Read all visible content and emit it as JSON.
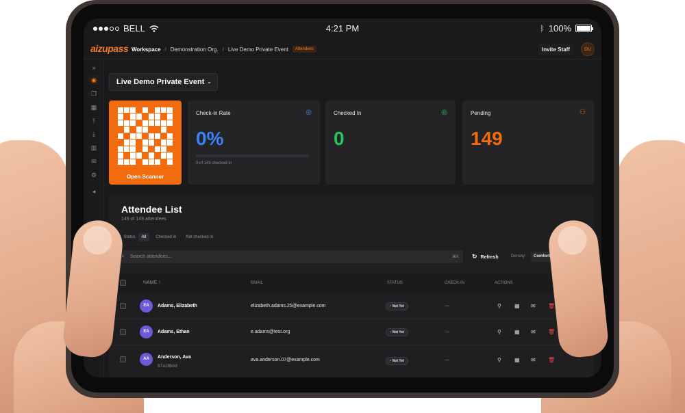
{
  "status_bar": {
    "carrier": "BELL",
    "time": "4:21 PM",
    "battery": "100%",
    "battery_level": 1.0
  },
  "header": {
    "logo": "aizupass",
    "breadcrumbs": [
      "Workspace",
      "Demonstration Org.",
      "Live Demo Private Event"
    ],
    "page_badge": "Attendees",
    "invite_label": "Invite Staff",
    "user_initials": "DU"
  },
  "sidebar": {
    "icons": [
      "expand-icon",
      "eye-icon",
      "layers-icon",
      "layout-icon",
      "upload-icon",
      "download-icon",
      "chart-icon",
      "badge-icon",
      "settings-icon",
      "collapse-icon"
    ]
  },
  "event_selector": {
    "label": "Live Demo Private Event"
  },
  "scanner": {
    "label": "Open Scanner"
  },
  "stats": {
    "checkin_rate": {
      "title": "Check-in Rate",
      "value": "0%",
      "subtext": "0 of 149 checked in",
      "progress": 0,
      "color": "#3b82f6"
    },
    "checked_in": {
      "title": "Checked In",
      "value": "0",
      "color": "#22c55e"
    },
    "pending": {
      "title": "Pending",
      "value": "149",
      "color": "#f26b0f"
    }
  },
  "attendee_list": {
    "title": "Attendee List",
    "subtitle": "149 of 149 attendees",
    "filter_label": "Status",
    "filters": [
      "All",
      "Checked in",
      "Not checked in"
    ],
    "active_filter": "All",
    "search_placeholder": "Search attendees...",
    "search_shortcut": "⌘K",
    "refresh_label": "Refresh",
    "density_label": "Density:",
    "density_value": "Comfortable",
    "columns": [
      "NAME",
      "EMAIL",
      "STATUS",
      "CHECK-IN",
      "ACTIONS"
    ],
    "rows": [
      {
        "initials": "EA",
        "name": "Adams, Elizabeth",
        "code": "",
        "email": "elizabeth.adams.25@example.com",
        "status": "Not Yet",
        "checkin": "—"
      },
      {
        "initials": "EA",
        "name": "Adams, Ethan",
        "code": "",
        "email": "e.adams@test.org",
        "status": "Not Yet",
        "checkin": "—"
      },
      {
        "initials": "AA",
        "name": "Anderson, Ava",
        "code": "87a18bbd",
        "email": "ava.anderson.07@example.com",
        "status": "Not Yet",
        "checkin": "—"
      }
    ]
  },
  "colors": {
    "accent": "#f26b0f",
    "background": "#1a1a1c",
    "avatar": "#6d5ad9"
  }
}
